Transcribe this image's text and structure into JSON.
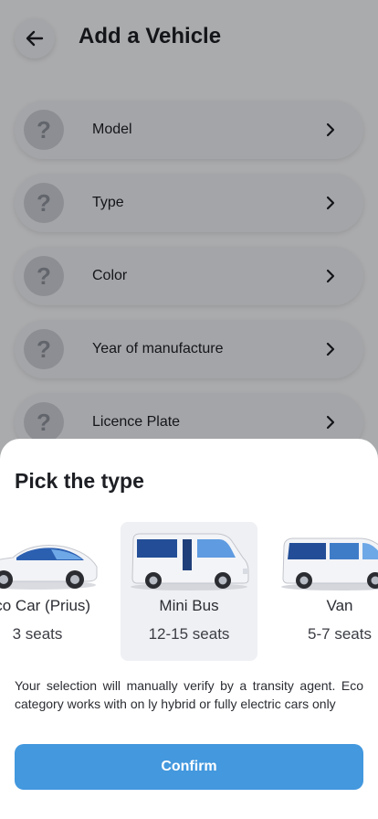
{
  "header": {
    "title": "Add a Vehicle",
    "back_icon": "arrow-left-icon"
  },
  "fields": [
    {
      "icon": "question-icon",
      "glyph": "?",
      "label": "Model"
    },
    {
      "icon": "question-icon",
      "glyph": "?",
      "label": "Type"
    },
    {
      "icon": "question-icon",
      "glyph": "?",
      "label": "Color"
    },
    {
      "icon": "question-icon",
      "glyph": "?",
      "label": "Year of manufacture"
    },
    {
      "icon": "question-icon",
      "glyph": "?",
      "label": "Licence Plate"
    }
  ],
  "sheet": {
    "title": "Pick the type",
    "types": [
      {
        "name": "Eco Car (Prius)",
        "seats": "3 seats",
        "selected": false,
        "badge": "leaf-icon"
      },
      {
        "name": "Mini Bus",
        "seats": "12-15 seats",
        "selected": true
      },
      {
        "name": "Van",
        "seats": "5-7 seats",
        "selected": false
      }
    ],
    "note": "Your selection will manually verify by a transity agent. Eco category works with on ly hybrid or fully electric cars only",
    "confirm_label": "Confirm"
  },
  "colors": {
    "accent": "#4398de",
    "eco_badge": "#4ec07a",
    "selected_card": "#eff0f4"
  }
}
